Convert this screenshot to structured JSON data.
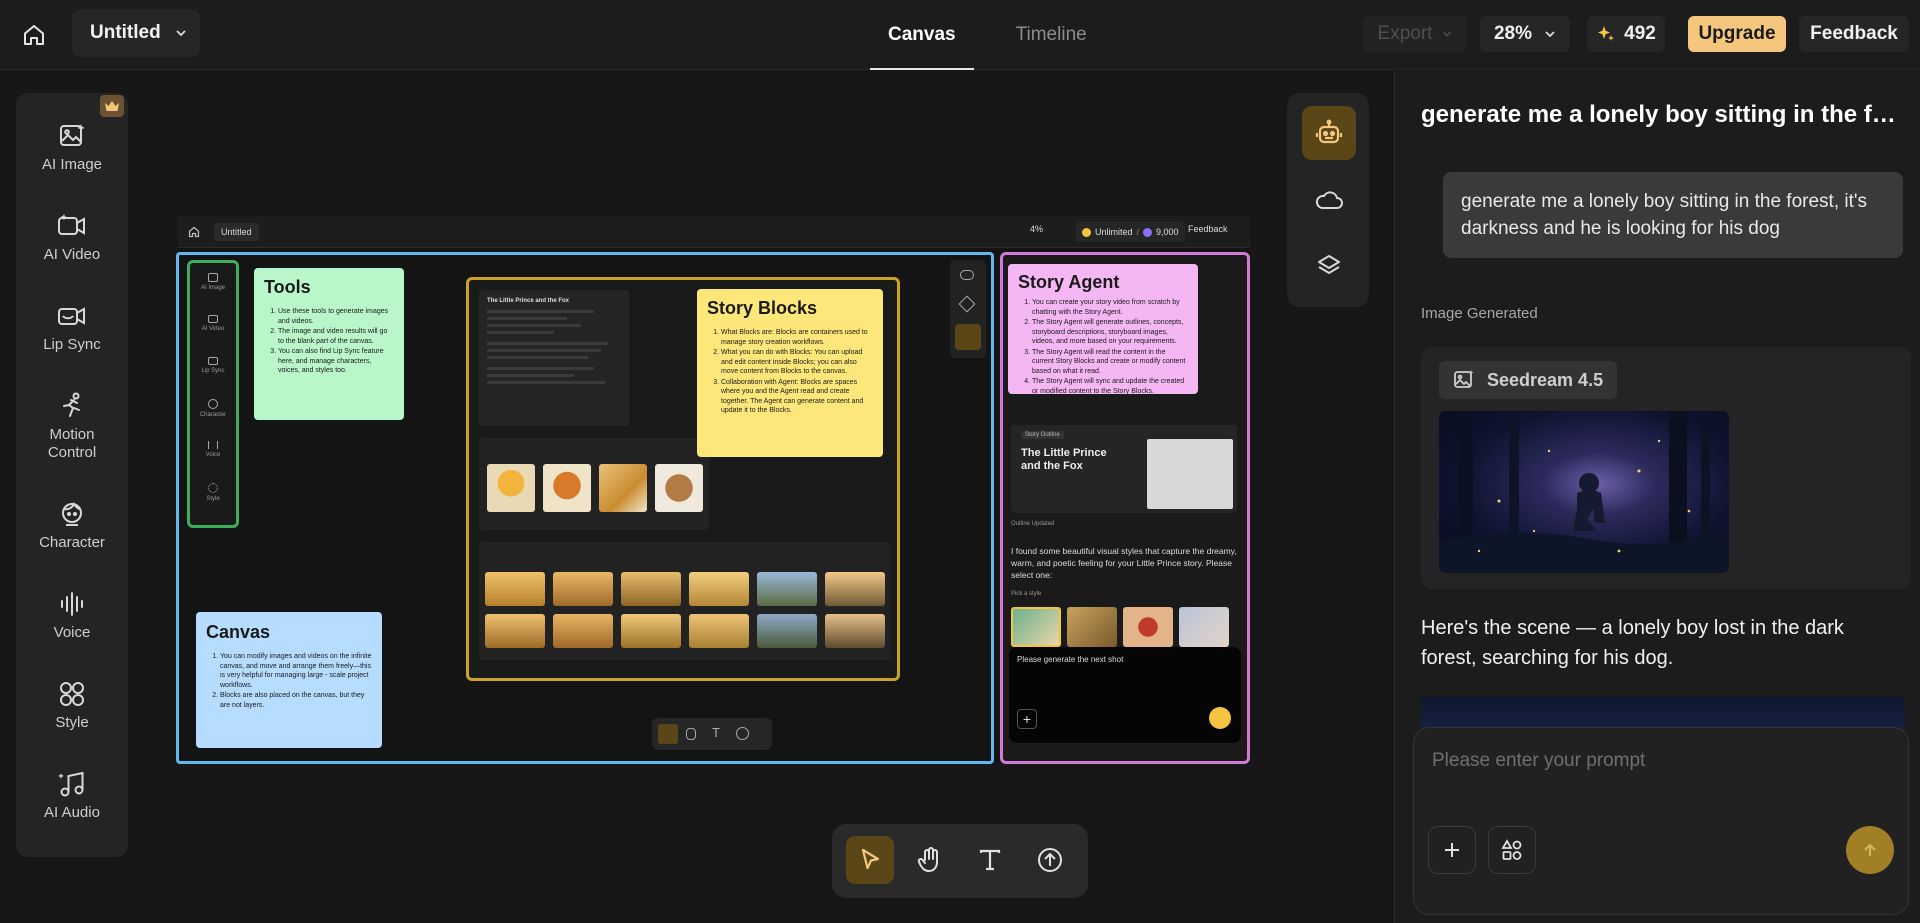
{
  "header": {
    "title": "Untitled",
    "tabs": [
      {
        "label": "Canvas",
        "active": true
      },
      {
        "label": "Timeline",
        "active": false
      }
    ],
    "export_label": "Export",
    "zoom": "28%",
    "credits": "492",
    "upgrade_label": "Upgrade",
    "feedback_label": "Feedback"
  },
  "sidebar": {
    "items": [
      {
        "label": "AI Image",
        "icon": "ai-image-icon"
      },
      {
        "label": "AI Video",
        "icon": "ai-video-icon"
      },
      {
        "label": "Lip Sync",
        "icon": "lip-sync-icon"
      },
      {
        "label": "Motion\nControl",
        "icon": "motion-control-icon"
      },
      {
        "label": "Character",
        "icon": "character-icon"
      },
      {
        "label": "Voice",
        "icon": "voice-icon"
      },
      {
        "label": "Style",
        "icon": "style-icon"
      },
      {
        "label": "AI Audio",
        "icon": "ai-audio-icon"
      }
    ]
  },
  "preview": {
    "title": "Untitled",
    "zoom": "4%",
    "plan": "Unlimited",
    "credits": "9,000",
    "feedback": "Feedback",
    "side_items": [
      "AI Image",
      "AI Video",
      "Lip Sync",
      "Character",
      "Voice",
      "Style"
    ],
    "tools_note": {
      "title": "Tools",
      "items": [
        "Use these tools to generate images and videos.",
        "The image and video results will go to the blank part of the canvas.",
        "You can also find Lip Sync feature here, and manage characters, voices, and styles too."
      ]
    },
    "blocks_note": {
      "title": "Story Blocks",
      "items": [
        "What Blocks are: Blocks are containers used to manage story creation workflows.",
        "What you can do with Blocks: You can upload and edit content inside Blocks; you can also move content from Blocks to the canvas.",
        "Collaboration with Agent: Blocks are spaces where you and the Agent read and create together. The Agent can generate content and update it to the Blocks."
      ]
    },
    "canvas_note": {
      "title": "Canvas",
      "items": [
        "You can modify images and videos on the infinite canvas, and move and arrange them freely—this is very helpful for managing large - scale project workflows.",
        "Blocks are also placed on the canvas, but they are not layers."
      ]
    },
    "agent_note": {
      "title": "Story Agent",
      "items": [
        "You can create your story video from scratch by chatting with the Story Agent.",
        "The Story Agent will generate outlines, concepts, storyboard descriptions, storyboard images, videos, and more based on your requirements.",
        "The Story Agent will read the content in the current Story Blocks and create or modify content based on what it read.",
        "The Story Agent will sync and update the created or modified content to the Story Blocks."
      ]
    },
    "outline_tag": "Story Outline",
    "outline_title": "The Little Prince and the Fox",
    "outline_updated": "Outline Updated",
    "agent_message": "I found some beautiful visual styles that capture the dreamy, warm, and poetic feeling for your Little Prince story. Please select one:",
    "pick_style": "Pick a style",
    "agent_input": "Please generate the next shot",
    "block_outline_title": "The Little Prince and the Fox"
  },
  "chat": {
    "title": "generate me a lonely boy sitting in the forest, it's darkness and he is looking for his dog",
    "user_message": "generate me a lonely boy sitting in the forest, it's darkness and he is looking for his dog",
    "generated_label": "Image Generated",
    "model": "Seedream 4.5",
    "reply": "Here's the scene — a lonely boy lost in the dark forest, searching for his dog.",
    "input_placeholder": "Please enter your prompt"
  },
  "colors": {
    "accent": "#f5c77e",
    "tools_note": "#b9f6ca",
    "blocks_note": "#fde77a",
    "canvas_note": "#b6dcff",
    "agent_note": "#f4b7f4",
    "frame_blue": "#5fb8f0",
    "frame_gold": "#c9a227",
    "frame_pink": "#d27ad9",
    "frame_green": "#3fae5a"
  }
}
